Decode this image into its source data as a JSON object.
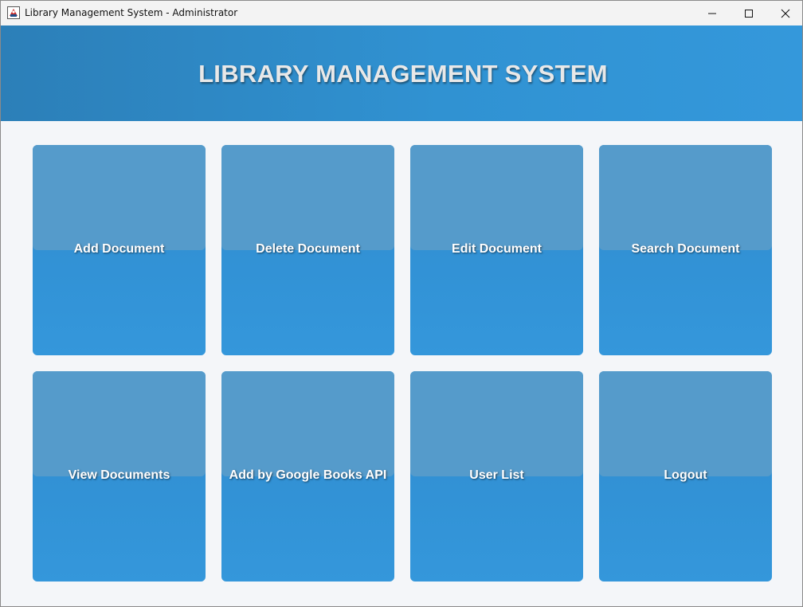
{
  "window": {
    "title": "Library Management System - Administrator",
    "app_icon": "java-cup-icon",
    "controls": {
      "minimize_icon": "minimize-icon",
      "maximize_icon": "maximize-icon",
      "close_icon": "close-icon"
    }
  },
  "header": {
    "title": "LIBRARY MANAGEMENT SYSTEM"
  },
  "tiles": [
    {
      "label": "Add Document"
    },
    {
      "label": "Delete Document"
    },
    {
      "label": "Edit Document"
    },
    {
      "label": "Search Document"
    },
    {
      "label": "View Documents"
    },
    {
      "label": "Add by Google Books API"
    },
    {
      "label": "User List"
    },
    {
      "label": "Logout"
    }
  ],
  "colors": {
    "banner_left": "#2c7fb8",
    "banner_right": "#3498db",
    "tile": "#3092d2",
    "tile_top": "#559bcb",
    "background": "#f4f6f9",
    "header_text": "#e8e8e8"
  }
}
